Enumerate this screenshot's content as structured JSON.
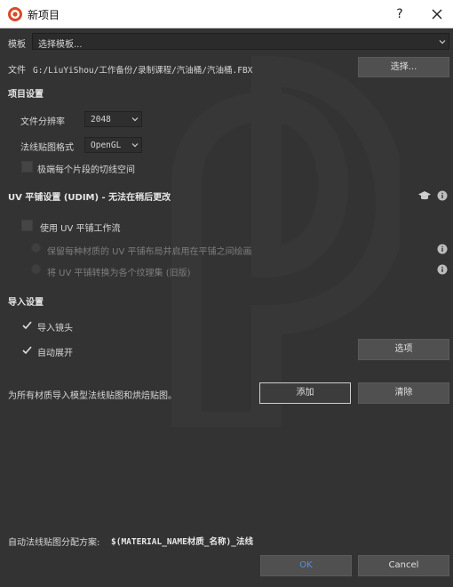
{
  "window": {
    "title": "新项目",
    "help": "?",
    "close_icon": "close-icon",
    "app_icon": "substance-painter-icon"
  },
  "template": {
    "label": "模板",
    "value": "选择模板..."
  },
  "file": {
    "label": "文件",
    "path": "G:/LiuYiShou/工作备份/录制课程/汽油桶/汽油桶.FBX",
    "select_button": "选择..."
  },
  "project_settings": {
    "heading": "项目设置",
    "resolution_label": "文件分辨率",
    "resolution_value": "2048",
    "normal_format_label": "法线贴图格式",
    "normal_format_value": "OpenGL",
    "tangent_checkbox_label": "极端每个片段的切线空间"
  },
  "uv_tile": {
    "heading": "UV 平铺设置 (UDIM) - 无法在稍后更改",
    "use_workflow_label": "使用 UV 平铺工作流",
    "option_preserve": "保留每种材质的 UV 平铺布局并启用在平铺之间绘画",
    "option_convert": "将 UV 平铺转换为各个纹理集 (旧版)"
  },
  "import_settings": {
    "heading": "导入设置",
    "import_cameras_label": "导入镜头",
    "auto_unwrap_label": "自动展开",
    "options_button": "选项"
  },
  "bake": {
    "description": "为所有材质导入模型法线贴图和烘焙贴图。",
    "add_button": "添加",
    "clear_button": "清除"
  },
  "footer": {
    "naming_label": "自动法线贴图分配方案:",
    "naming_value": "$(MATERIAL_NAME材质_名称)_法线",
    "ok_button": "OK",
    "cancel_button": "Cancel"
  },
  "colors": {
    "background": "#333333",
    "titlebar": "#ffffff",
    "button": "#505050",
    "text": "#d6d6d6",
    "accent_ok": "#5a8fd8"
  }
}
